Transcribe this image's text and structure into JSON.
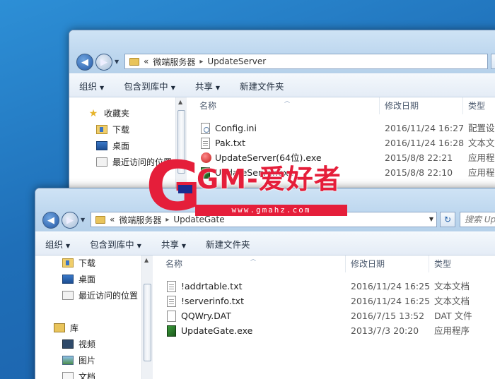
{
  "win1": {
    "address": {
      "crumb_prefix": "«",
      "crumb_1": "微端服务器",
      "sep": "▸",
      "crumb_2": "UpdateServer"
    },
    "toolbar": {
      "organize": "组织",
      "include": "包含到库中",
      "share": "共享",
      "new_folder": "新建文件夹",
      "arrow": "▼"
    },
    "nav": {
      "favorites": "收藏夹",
      "downloads": "下载",
      "desktop": "桌面",
      "recent": "最近访问的位置"
    },
    "columns": {
      "name": "名称",
      "date": "修改日期",
      "type": "类型"
    },
    "files": [
      {
        "name": "Config.ini",
        "date": "2016/11/24 16:27",
        "type": "配置设"
      },
      {
        "name": "Pak.txt",
        "date": "2016/11/24 16:28",
        "type": "文本文"
      },
      {
        "name": "UpdateServer(64位).exe",
        "date": "2015/8/8 22:21",
        "type": "应用程"
      },
      {
        "name": "UpdateServer.exe",
        "date": "2015/8/8 22:10",
        "type": "应用程"
      }
    ]
  },
  "win2": {
    "address": {
      "crumb_prefix": "«",
      "crumb_1": "微端服务器",
      "sep": "▸",
      "crumb_2": "UpdateGate"
    },
    "search_placeholder": "搜索 Up",
    "toolbar": {
      "organize": "组织",
      "include": "包含到库中",
      "share": "共享",
      "new_folder": "新建文件夹",
      "arrow": "▼"
    },
    "nav": {
      "downloads": "下载",
      "desktop": "桌面",
      "recent": "最近访问的位置",
      "library": "库",
      "video": "视频",
      "pictures": "图片",
      "documents": "文档"
    },
    "columns": {
      "name": "名称",
      "date": "修改日期",
      "type": "类型"
    },
    "files": [
      {
        "name": "!addrtable.txt",
        "date": "2016/11/24 16:25",
        "type": "文本文档"
      },
      {
        "name": "!serverinfo.txt",
        "date": "2016/11/24 16:25",
        "type": "文本文档"
      },
      {
        "name": "QQWry.DAT",
        "date": "2016/7/15 13:52",
        "type": "DAT 文件"
      },
      {
        "name": "UpdateGate.exe",
        "date": "2013/7/3 20:20",
        "type": "应用程序"
      }
    ]
  },
  "watermark": {
    "letter": "G",
    "text": "GM-爱好者",
    "url": "www.gmahz.com"
  },
  "colors": {
    "accent": "#e51e3a",
    "desktop": "#1f6fb8",
    "chrome": "#bcd6ee"
  }
}
